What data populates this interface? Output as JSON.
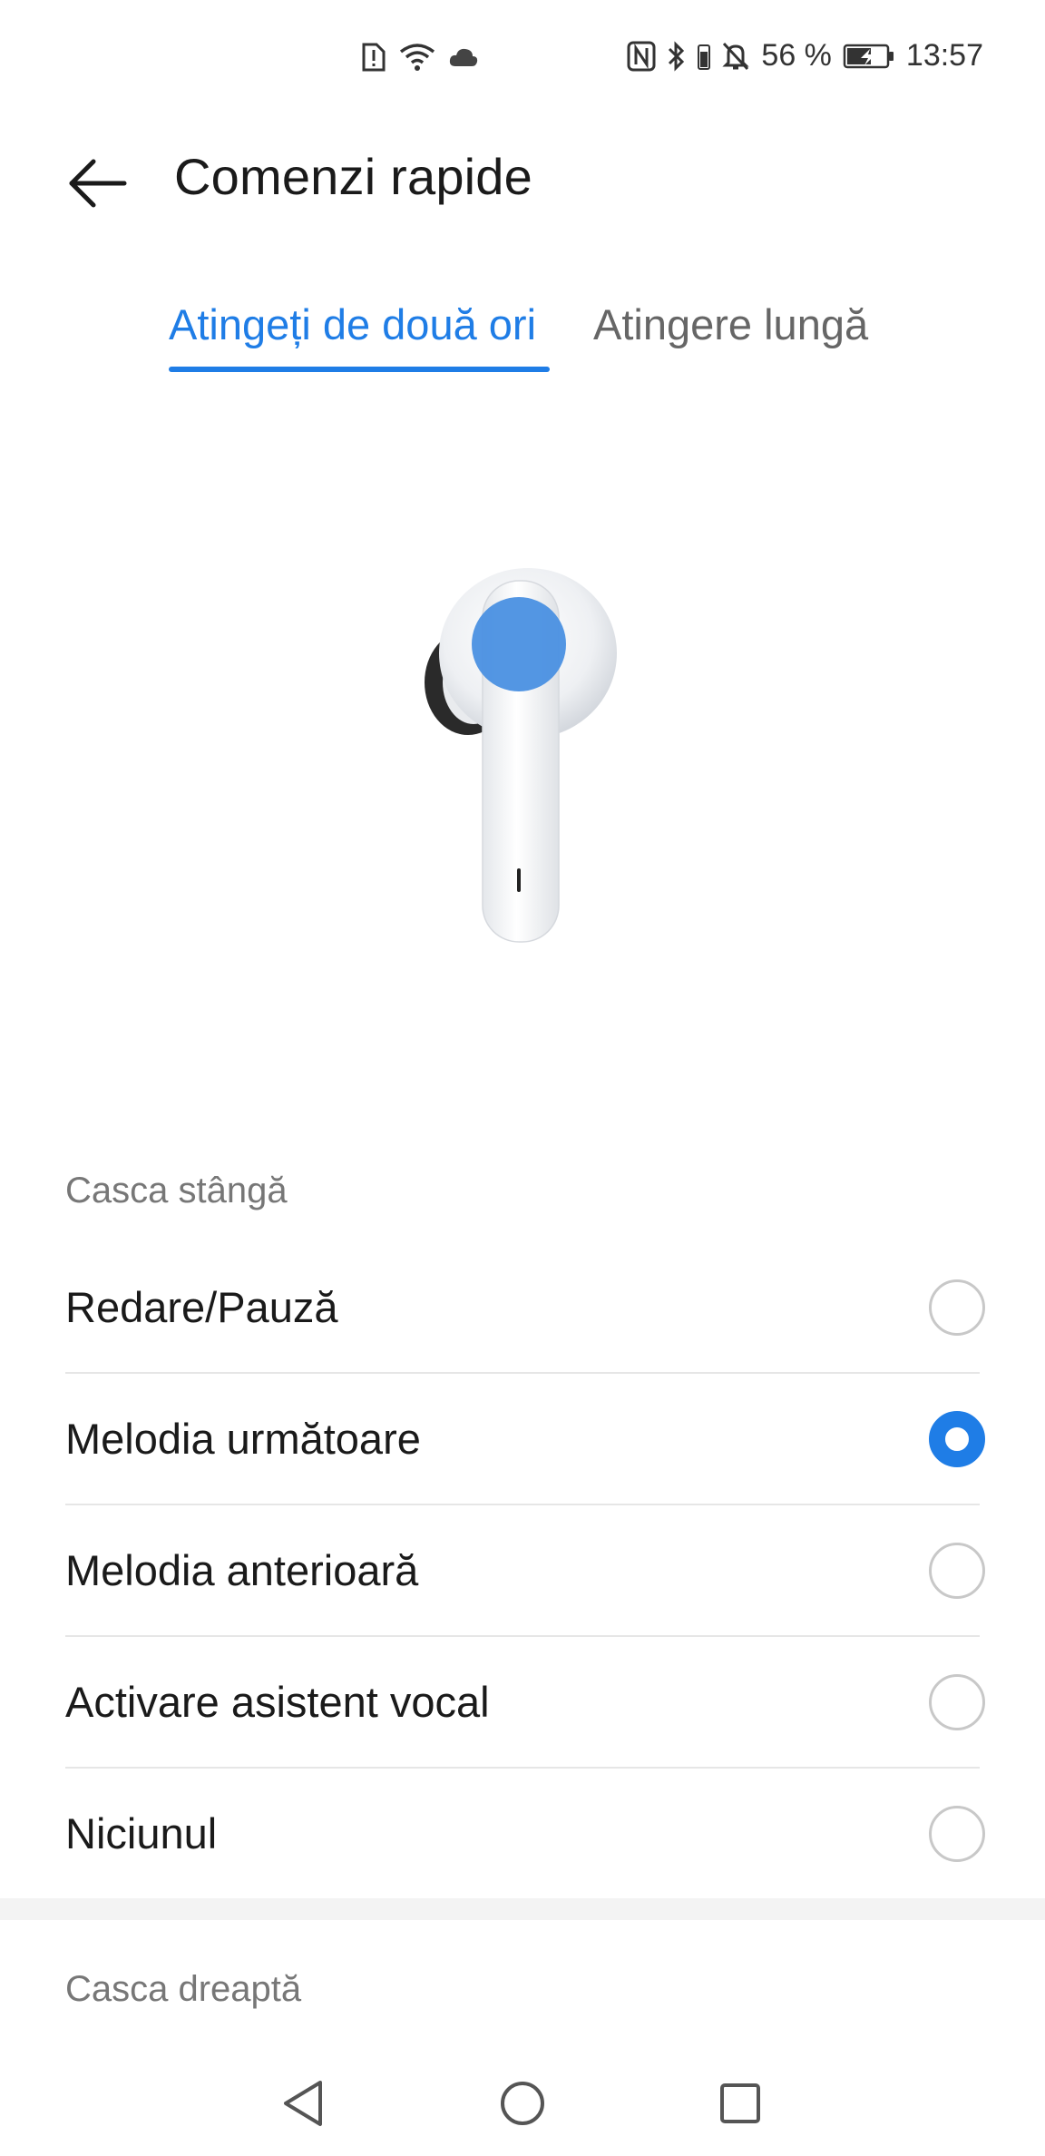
{
  "status_bar": {
    "left_icons": [
      "sim-alert-icon",
      "wifi-icon",
      "cloud-icon"
    ],
    "right_icons": [
      "nfc-icon",
      "bluetooth-icon",
      "mute-bell-icon"
    ],
    "battery_percent": "56 %",
    "battery_icon": "battery-charging-icon",
    "time": "13:57"
  },
  "app_bar": {
    "back_icon": "arrow-back-icon",
    "title": "Comenzi rapide"
  },
  "tabs": [
    {
      "label": "Atingeți de două ori",
      "active": true
    },
    {
      "label": "Atingere lungă",
      "active": false
    }
  ],
  "illustration": {
    "icon": "earbud-icon",
    "highlight_color": "#4a90e2"
  },
  "left_earbud": {
    "header": "Casca stângă",
    "options": [
      {
        "label": "Redare/Pauză",
        "selected": false
      },
      {
        "label": "Melodia următoare",
        "selected": true
      },
      {
        "label": "Melodia anterioară",
        "selected": false
      },
      {
        "label": "Activare asistent vocal",
        "selected": false
      },
      {
        "label": "Niciunul",
        "selected": false
      }
    ]
  },
  "right_earbud": {
    "header": "Casca dreaptă"
  },
  "nav_bar": {
    "buttons": [
      "back-triangle-icon",
      "home-circle-icon",
      "recents-square-icon"
    ]
  },
  "colors": {
    "accent": "#1f7de6",
    "text_primary": "#1a1a1a",
    "text_secondary": "#777777",
    "divider": "#e6e6e6"
  }
}
